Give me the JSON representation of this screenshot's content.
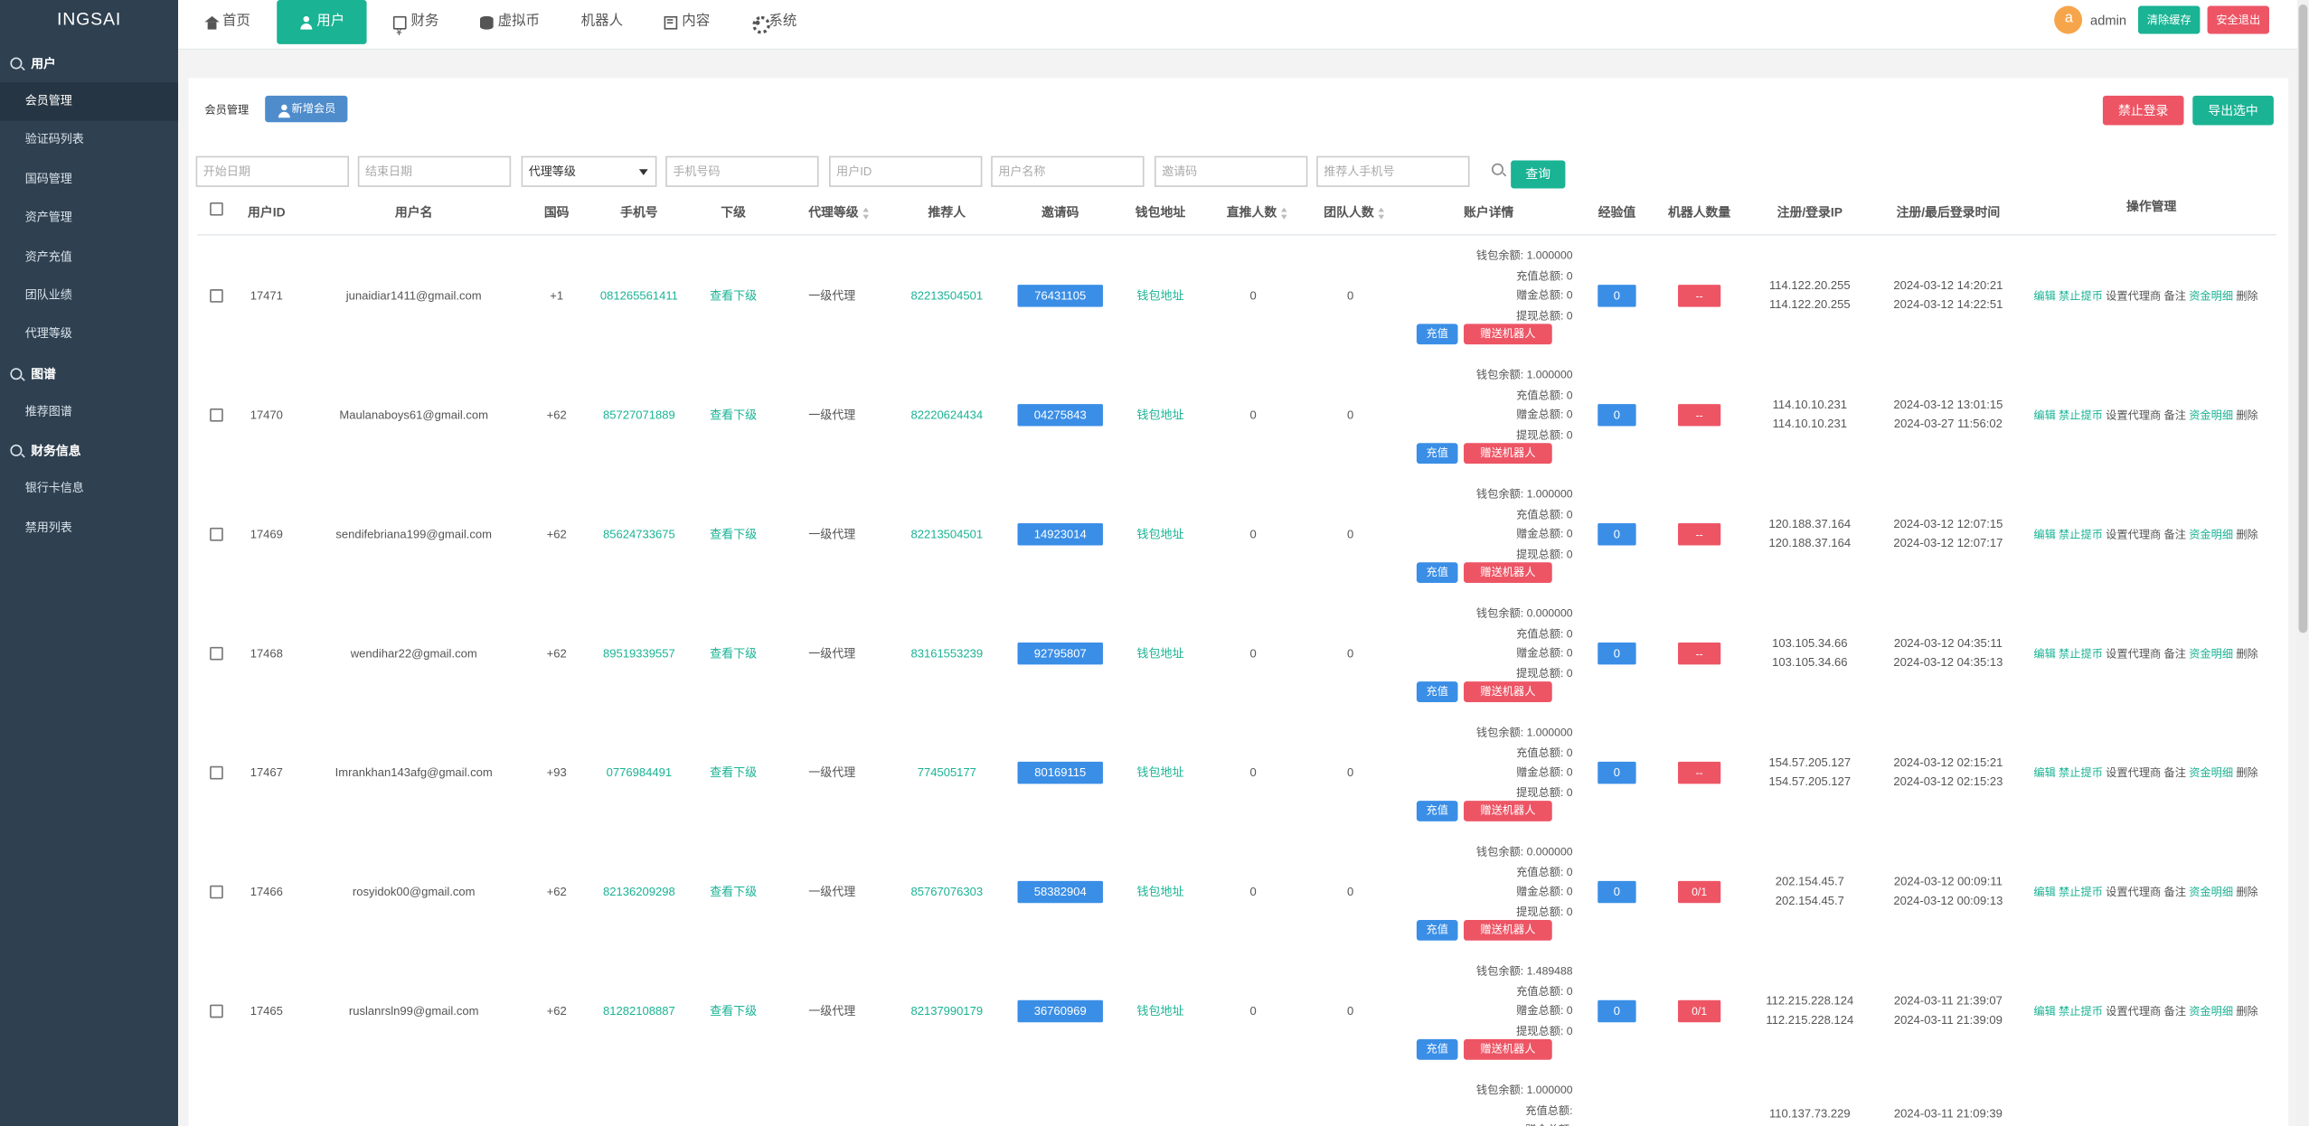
{
  "app": {
    "brand": "INGSAI"
  },
  "sidebar": {
    "groups": [
      {
        "title": "用户",
        "items": [
          {
            "label": "会员管理",
            "active": true
          },
          {
            "label": "验证码列表"
          },
          {
            "label": "国码管理"
          },
          {
            "label": "资产管理"
          },
          {
            "label": "资产充值"
          },
          {
            "label": "团队业绩"
          },
          {
            "label": "代理等级"
          }
        ]
      },
      {
        "title": "图谱",
        "items": [
          {
            "label": "推荐图谱"
          }
        ]
      },
      {
        "title": "财务信息",
        "items": [
          {
            "label": "银行卡信息"
          },
          {
            "label": "禁用列表"
          }
        ]
      }
    ]
  },
  "topnav": {
    "items": [
      {
        "label": "首页",
        "icon": "home-icon"
      },
      {
        "label": "用户",
        "icon": "user-icon",
        "active": true
      },
      {
        "label": "财务",
        "icon": "finance-icon"
      },
      {
        "label": "虚拟币",
        "icon": "database-icon"
      },
      {
        "label": "机器人",
        "icon": ""
      },
      {
        "label": "内容",
        "icon": "content-icon"
      },
      {
        "label": "系统",
        "icon": "gear-icon"
      }
    ],
    "avatar_letter": "a",
    "username": "admin",
    "clear_cache": "清除缓存",
    "logout": "安全退出"
  },
  "page": {
    "title": "会员管理",
    "add_member": "新增会员",
    "ban_login": "禁止登录",
    "export_selected": "导出选中"
  },
  "filters": {
    "start_date": "开始日期",
    "end_date": "结束日期",
    "agent_level": "代理等级",
    "phone": "手机号码",
    "user_id": "用户ID",
    "username": "用户名称",
    "invite_code": "邀请码",
    "referrer_phone": "推荐人手机号",
    "query": "查询"
  },
  "table": {
    "headers": {
      "user_id": "用户ID",
      "username": "用户名",
      "country_code": "国码",
      "phone": "手机号",
      "subordinate": "下级",
      "agent_level": "代理等级",
      "referrer": "推荐人",
      "invite_code": "邀请码",
      "wallet": "钱包地址",
      "direct_count": "直推人数",
      "team_count": "团队人数",
      "account": "账户详情",
      "exp": "经验值",
      "robots": "机器人数量",
      "ip": "注册/登录IP",
      "time": "注册/最后登录时间",
      "ops": "操作管理"
    },
    "account_labels": {
      "balance": "钱包余额:",
      "recharge": "充值总额:",
      "gift": "赠金总额:",
      "withdraw": "提现总额:"
    },
    "action_labels": {
      "view_sub": "查看下级",
      "wallet": "钱包地址",
      "recharge": "充值",
      "gift_robot": "赠送机器人",
      "edit": "编辑",
      "ban_withdraw": "禁止提币",
      "set_agent": "设置代理商",
      "note": "备注",
      "funds": "资金明细",
      "delete": "删除"
    },
    "rows": [
      {
        "id": "17471",
        "username": "junaidiar1411@gmail.com",
        "cc": "+1",
        "phone": "081265561411",
        "level": "一级代理",
        "referrer": "82213504501",
        "invite": "76431105",
        "direct": "0",
        "team": "0",
        "balance": "1.000000",
        "recharge": "0",
        "gift": "0",
        "withdraw": "0",
        "exp": "0",
        "robots": "--",
        "ip1": "114.122.20.255",
        "ip2": "114.122.20.255",
        "t1": "2024-03-12 14:20:21",
        "t2": "2024-03-12 14:22:51"
      },
      {
        "id": "17470",
        "username": "Maulanaboys61@gmail.com",
        "cc": "+62",
        "phone": "85727071889",
        "level": "一级代理",
        "referrer": "82220624434",
        "invite": "04275843",
        "direct": "0",
        "team": "0",
        "balance": "1.000000",
        "recharge": "0",
        "gift": "0",
        "withdraw": "0",
        "exp": "0",
        "robots": "--",
        "ip1": "114.10.10.231",
        "ip2": "114.10.10.231",
        "t1": "2024-03-12 13:01:15",
        "t2": "2024-03-27 11:56:02"
      },
      {
        "id": "17469",
        "username": "sendifebriana199@gmail.com",
        "cc": "+62",
        "phone": "85624733675",
        "level": "一级代理",
        "referrer": "82213504501",
        "invite": "14923014",
        "direct": "0",
        "team": "0",
        "balance": "1.000000",
        "recharge": "0",
        "gift": "0",
        "withdraw": "0",
        "exp": "0",
        "robots": "--",
        "ip1": "120.188.37.164",
        "ip2": "120.188.37.164",
        "t1": "2024-03-12 12:07:15",
        "t2": "2024-03-12 12:07:17"
      },
      {
        "id": "17468",
        "username": "wendihar22@gmail.com",
        "cc": "+62",
        "phone": "89519339557",
        "level": "一级代理",
        "referrer": "83161553239",
        "invite": "92795807",
        "direct": "0",
        "team": "0",
        "balance": "0.000000",
        "recharge": "0",
        "gift": "0",
        "withdraw": "0",
        "exp": "0",
        "robots": "--",
        "ip1": "103.105.34.66",
        "ip2": "103.105.34.66",
        "t1": "2024-03-12 04:35:11",
        "t2": "2024-03-12 04:35:13"
      },
      {
        "id": "17467",
        "username": "Imrankhan143afg@gmail.com",
        "cc": "+93",
        "phone": "0776984491",
        "level": "一级代理",
        "referrer": "774505177",
        "invite": "80169115",
        "direct": "0",
        "team": "0",
        "balance": "1.000000",
        "recharge": "0",
        "gift": "0",
        "withdraw": "0",
        "exp": "0",
        "robots": "--",
        "ip1": "154.57.205.127",
        "ip2": "154.57.205.127",
        "t1": "2024-03-12 02:15:21",
        "t2": "2024-03-12 02:15:23"
      },
      {
        "id": "17466",
        "username": "rosyidok00@gmail.com",
        "cc": "+62",
        "phone": "82136209298",
        "level": "一级代理",
        "referrer": "85767076303",
        "invite": "58382904",
        "direct": "0",
        "team": "0",
        "balance": "0.000000",
        "recharge": "0",
        "gift": "0",
        "withdraw": "0",
        "exp": "0",
        "robots": "0/1",
        "ip1": "202.154.45.7",
        "ip2": "202.154.45.7",
        "t1": "2024-03-12 00:09:11",
        "t2": "2024-03-12 00:09:13"
      },
      {
        "id": "17465",
        "username": "ruslanrsln99@gmail.com",
        "cc": "+62",
        "phone": "81282108887",
        "level": "一级代理",
        "referrer": "82137990179",
        "invite": "36760969",
        "direct": "0",
        "team": "0",
        "balance": "1.489488",
        "recharge": "0",
        "gift": "0",
        "withdraw": "0",
        "exp": "0",
        "robots": "0/1",
        "ip1": "112.215.228.124",
        "ip2": "112.215.228.124",
        "t1": "2024-03-11 21:39:07",
        "t2": "2024-03-11 21:39:09"
      },
      {
        "id": "",
        "username": "",
        "cc": "",
        "phone": "",
        "level": "",
        "referrer": "",
        "invite": "",
        "direct": "",
        "team": "",
        "balance": "1.000000",
        "recharge": "",
        "gift": "",
        "withdraw": "",
        "exp": "",
        "robots": "",
        "ip1": "110.137.73.229",
        "ip2": "",
        "t1": "2024-03-11 21:09:39",
        "t2": ""
      }
    ]
  },
  "colors": {
    "sidebar_bg": "#2f4050",
    "accent_green": "#1ab394",
    "danger_red": "#ed5565",
    "primary_blue": "#3a8ee6"
  }
}
